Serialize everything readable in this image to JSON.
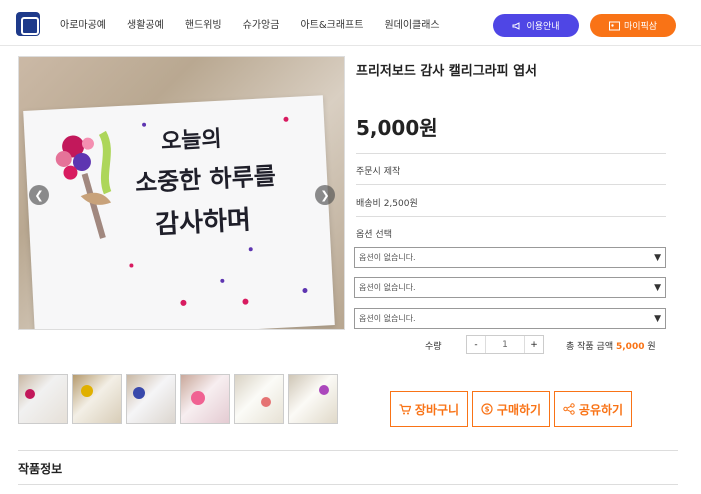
{
  "header": {
    "nav": [
      "아로마공예",
      "생활공예",
      "핸드위빙",
      "슈가앙금",
      "아트&크래프트",
      "원데이클래스"
    ],
    "guide_label": "이용안내",
    "mypage_label": "마이픽삼",
    "accent_purple": "#4f46e5",
    "accent_orange": "#f97316"
  },
  "product": {
    "title": "프리저보드 감사 캘리그라피 엽서",
    "price": "5,000원",
    "order_info": "주문시 제작",
    "shipping": "배송비 2,500원",
    "option_label": "옵션 선택",
    "options": [
      "옵션이 없습니다.",
      "옵션이 없습니다.",
      "옵션이 없습니다."
    ],
    "qty_label": "수량",
    "qty_minus": "-",
    "qty_value": "1",
    "qty_plus": "+",
    "total_label": "총 작품 금액",
    "total_amount": "5,000",
    "total_unit": "원"
  },
  "image": {
    "calligraphy": [
      "오늘의",
      "소중한 하루를",
      "감사하며"
    ],
    "prev_icon": "chevron-left-icon",
    "next_icon": "chevron-right-icon"
  },
  "actions": {
    "cart": "장바구니",
    "buy": "구매하기",
    "share": "공유하기"
  },
  "section": {
    "title": "작품정보"
  }
}
